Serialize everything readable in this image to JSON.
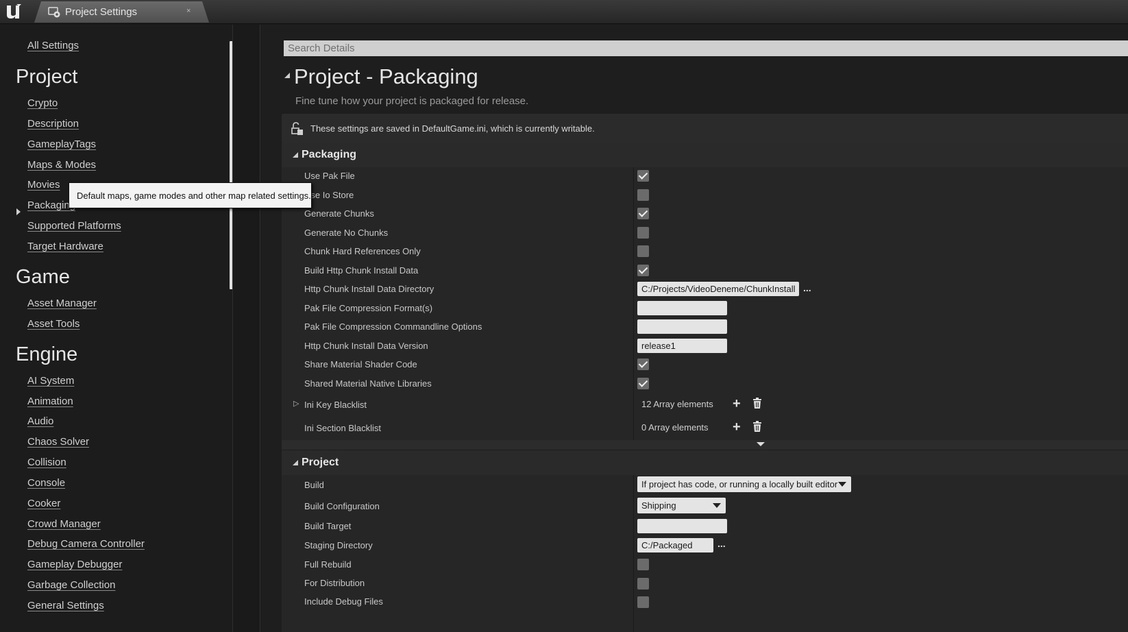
{
  "tab": {
    "title": "Project Settings",
    "close": "×"
  },
  "sidebar": {
    "all_settings": "All Settings",
    "sections": [
      {
        "heading": "Project",
        "items": [
          "Crypto",
          "Description",
          "GameplayTags",
          "Maps & Modes",
          "Movies",
          "Packaging",
          "Supported Platforms",
          "Target Hardware"
        ]
      },
      {
        "heading": "Game",
        "items": [
          "Asset Manager",
          "Asset Tools"
        ]
      },
      {
        "heading": "Engine",
        "items": [
          "AI System",
          "Animation",
          "Audio",
          "Chaos Solver",
          "Collision",
          "Console",
          "Cooker",
          "Crowd Manager",
          "Debug Camera Controller",
          "Gameplay Debugger",
          "Garbage Collection",
          "General Settings"
        ]
      }
    ],
    "selected": "Packaging"
  },
  "tooltip": {
    "text": "Default maps, game modes and other map related settings."
  },
  "search": {
    "placeholder": "Search Details"
  },
  "page": {
    "title": "Project - Packaging",
    "subtitle": "Fine tune how your project is packaged for release.",
    "notice": "These settings are saved in DefaultGame.ini, which is currently writable."
  },
  "packaging": {
    "title": "Packaging",
    "rows": [
      {
        "label": "Use Pak File",
        "type": "checkbox",
        "checked": true
      },
      {
        "label": "Use Io Store",
        "type": "checkbox",
        "checked": false
      },
      {
        "label": "Generate Chunks",
        "type": "checkbox",
        "checked": true
      },
      {
        "label": "Generate No Chunks",
        "type": "checkbox",
        "checked": false
      },
      {
        "label": "Chunk Hard References Only",
        "type": "checkbox",
        "checked": false
      },
      {
        "label": "Build Http Chunk Install Data",
        "type": "checkbox",
        "checked": true
      },
      {
        "label": "Http Chunk Install Data Directory",
        "type": "path",
        "value": "C:/Projects/VideoDeneme/ChunkInstall",
        "browse": "..."
      },
      {
        "label": "Pak File Compression Format(s)",
        "type": "text",
        "value": ""
      },
      {
        "label": "Pak File Compression Commandline Options",
        "type": "text",
        "value": ""
      },
      {
        "label": "Http Chunk Install Data Version",
        "type": "text",
        "value": "release1"
      },
      {
        "label": "Share Material Shader Code",
        "type": "checkbox",
        "checked": true
      },
      {
        "label": "Shared Material Native Libraries",
        "type": "checkbox",
        "checked": true
      },
      {
        "label": "Ini Key Blacklist",
        "type": "array",
        "value": "12 Array elements",
        "expandable": true
      },
      {
        "label": "Ini Section Blacklist",
        "type": "array",
        "value": "0 Array elements",
        "expandable": false
      }
    ]
  },
  "project": {
    "title": "Project",
    "rows": [
      {
        "label": "Build",
        "type": "dropdown",
        "value": "If project has code, or running a locally built editor"
      },
      {
        "label": "Build Configuration",
        "type": "dropdown",
        "value": "Shipping"
      },
      {
        "label": "Build Target",
        "type": "text",
        "value": ""
      },
      {
        "label": "Staging Directory",
        "type": "path",
        "value": "C:/Packaged",
        "browse": "..."
      },
      {
        "label": "Full Rebuild",
        "type": "checkbox",
        "checked": false
      },
      {
        "label": "For Distribution",
        "type": "checkbox",
        "checked": false
      },
      {
        "label": "Include Debug Files",
        "type": "checkbox",
        "checked": false
      }
    ]
  },
  "colors": {
    "background": "#1e1e1e",
    "panel": "#262626",
    "field": "#e4e4e4",
    "checkbox": "#6b6b6b"
  }
}
